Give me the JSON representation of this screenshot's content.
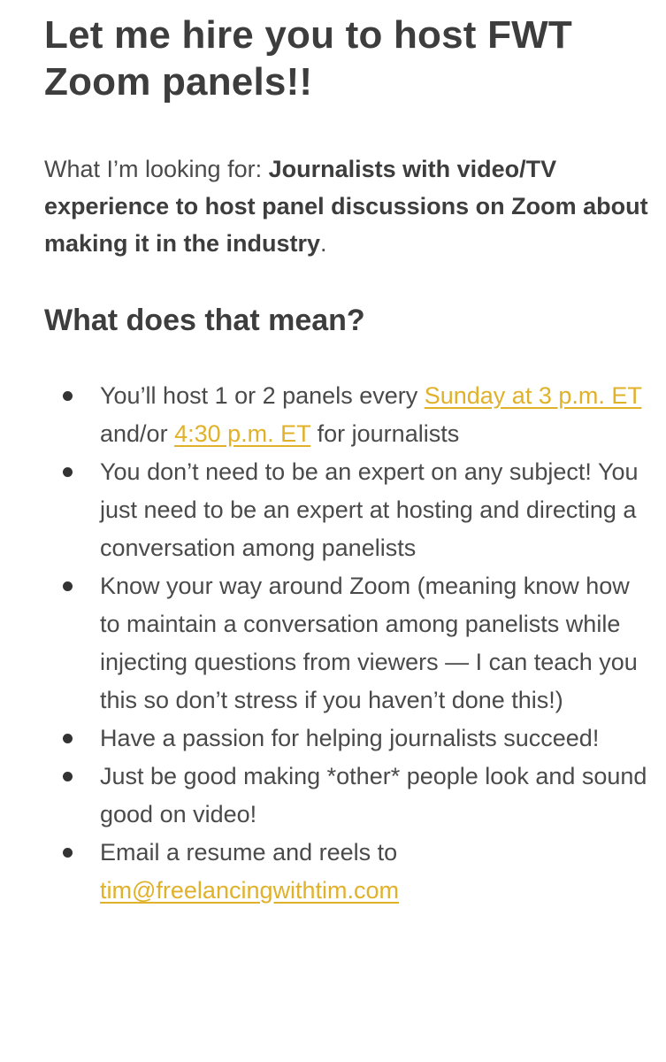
{
  "header": {
    "title": "Let me hire you to host FWT Zoom panels!!"
  },
  "intro": {
    "prefix": "What I’m looking for: ",
    "bold": "Journalists with video/TV experience to host panel discussions on Zoom about making it in the industry",
    "suffix": "."
  },
  "section": {
    "heading": "What does that mean?"
  },
  "bullets": {
    "b1": {
      "text_a": "You’ll host 1 or 2 panels every ",
      "link1": "Sunday at 3 p.m. ET",
      "text_b": " and/or ",
      "link2": "4:30 p.m. ET",
      "text_c": " for journalists"
    },
    "b2": {
      "text": "You don’t need to be an expert on any subject! You just need to be an expert at hosting and directing a conversation among panelists"
    },
    "b3": {
      "text": "Know your way around Zoom (meaning know how to maintain a conversation among panelists while injecting questions from viewers — I can teach you this so don’t stress if you haven’t done this!)"
    },
    "b4": {
      "text": "Have a passion for helping journalists succeed!"
    },
    "b5": {
      "text": "Just be good making *other* people look and sound good on video!"
    },
    "b6": {
      "text": "Email a resume and reels to ",
      "email": "tim@freelancingwithtim.com"
    }
  },
  "colors": {
    "link": "#e0b12a",
    "text": "#4a4a4a",
    "heading": "#3d3d3d",
    "background": "#ffffff"
  }
}
